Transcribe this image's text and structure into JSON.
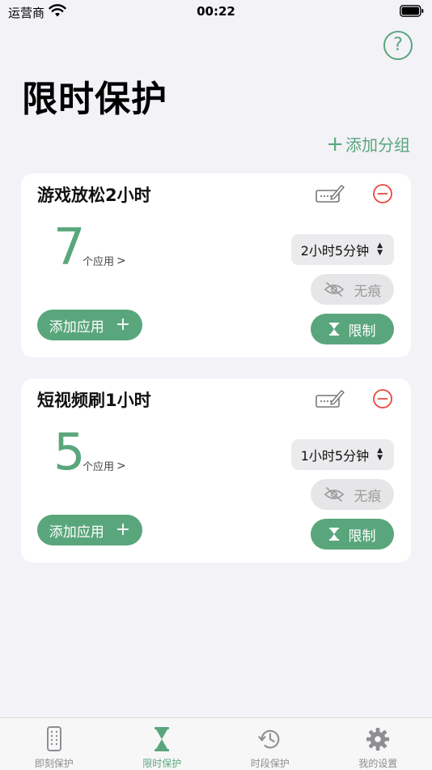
{
  "status_bar": {
    "carrier": "运营商",
    "time": "00:22"
  },
  "header": {
    "help_symbol": "?",
    "title": "限时保护",
    "add_group_label": "添加分组"
  },
  "groups": [
    {
      "name": "游戏放松2小时",
      "app_count": "7",
      "app_count_label": "个应用",
      "time_limit": "2小时5分钟",
      "traceless_label": "无痕",
      "add_app_label": "添加应用",
      "limit_label": "限制"
    },
    {
      "name": "短视频刷1小时",
      "app_count": "5",
      "app_count_label": "个应用",
      "time_limit": "1小时5分钟",
      "traceless_label": "无痕",
      "add_app_label": "添加应用",
      "limit_label": "限制"
    }
  ],
  "tab_bar": {
    "tabs": [
      {
        "label": "即刻保护",
        "icon": "phone-icon"
      },
      {
        "label": "限时保护",
        "icon": "hourglass-icon"
      },
      {
        "label": "时段保护",
        "icon": "clock-history-icon"
      },
      {
        "label": "我的设置",
        "icon": "gear-icon"
      }
    ],
    "active_index": 1
  },
  "colors": {
    "accent": "#5aa67c",
    "danger": "#e8473a",
    "background": "#f2f2f7"
  }
}
